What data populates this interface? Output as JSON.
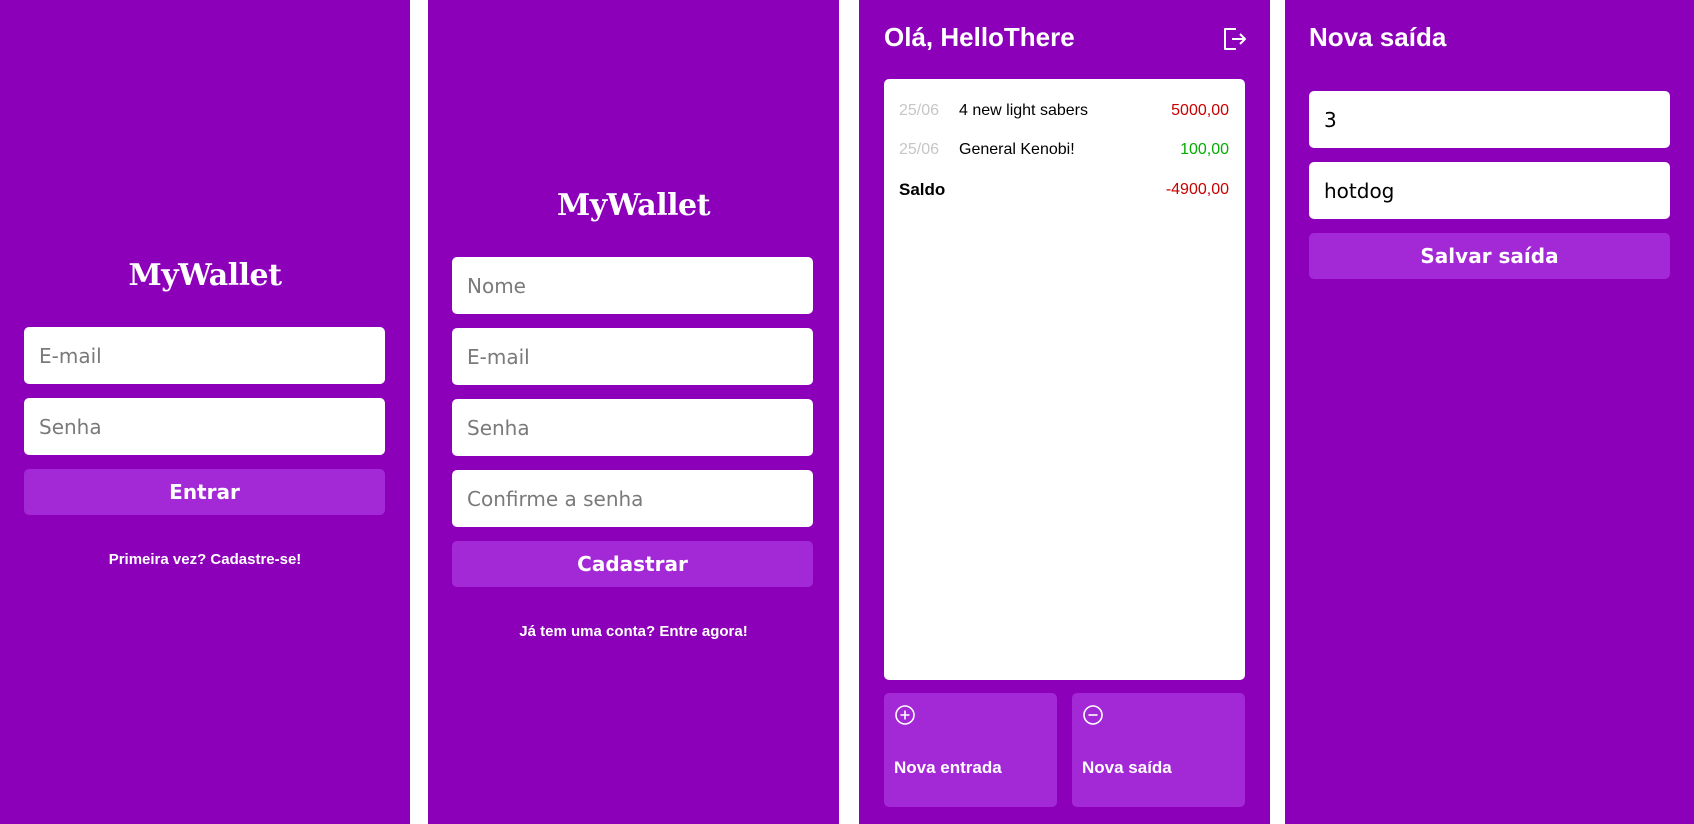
{
  "brand": {
    "logo": "MyWallet"
  },
  "login": {
    "email_placeholder": "E-mail",
    "password_placeholder": "Senha",
    "submit_label": "Entrar",
    "signup_link": "Primeira vez? Cadastre-se!"
  },
  "signup": {
    "name_placeholder": "Nome",
    "email_placeholder": "E-mail",
    "password_placeholder": "Senha",
    "confirm_placeholder": "Confirme a senha",
    "submit_label": "Cadastrar",
    "login_link": "Já tem uma conta? Entre agora!"
  },
  "home": {
    "greeting": "Olá, HelloThere",
    "logout_icon": "logout-icon",
    "records": [
      {
        "date": "25/06",
        "description": "4 new light sabers",
        "value": "5000,00",
        "type": "expense"
      },
      {
        "date": "25/06",
        "description": "General Kenobi!",
        "value": "100,00",
        "type": "income"
      }
    ],
    "balance_label": "Saldo",
    "balance_value": "-4900,00",
    "new_income_label": "Nova entrada",
    "new_income_icon": "plus-circle-icon",
    "new_expense_label": "Nova saída",
    "new_expense_icon": "minus-circle-icon"
  },
  "new_expense": {
    "title": "Nova saída",
    "amount_value": "3",
    "description_value": "hotdog",
    "save_label": "Salvar saída"
  },
  "colors": {
    "background": "#8c00b9",
    "button": "#a328d6",
    "expense": "#c70000",
    "income": "#03ac00",
    "date": "#c6c6c6"
  }
}
